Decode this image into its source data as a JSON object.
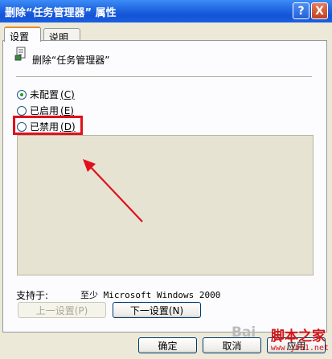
{
  "window": {
    "title": "删除“任务管理器” 属性",
    "help_glyph": "?",
    "close_glyph": "X"
  },
  "tabs": [
    {
      "label": "设置",
      "active": true
    },
    {
      "label": "说明",
      "active": false
    }
  ],
  "policy": {
    "icon": "policy-icon",
    "title": "删除“任务管理器”"
  },
  "options": [
    {
      "label": "未配置",
      "accel": "(C)",
      "checked": true
    },
    {
      "label": "已启用",
      "accel": "(E)",
      "checked": false
    },
    {
      "label": "已禁用",
      "accel": "(D)",
      "checked": false
    }
  ],
  "support": {
    "label": "支持于:",
    "value": "至少 Microsoft Windows 2000"
  },
  "nav": {
    "prev_label": "上一设置(P)",
    "next_label": "下一设置(N)"
  },
  "buttons": {
    "ok": "确定",
    "cancel": "取消",
    "apply": "应用"
  },
  "watermark": {
    "main": "脚本之家",
    "sub": "www.jb51.net",
    "baidu": "Bai"
  },
  "colors": {
    "highlight": "#E0101C",
    "titlebar": "#1F64E0",
    "dialog_bg": "#ECE9D8"
  }
}
